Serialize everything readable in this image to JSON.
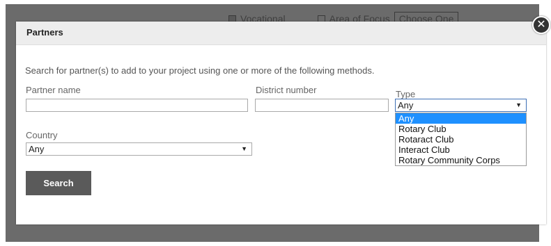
{
  "background": {
    "vocational_label": "Vocational",
    "area_of_focus_label": "Area of Focus",
    "area_of_focus_select": "Choose One"
  },
  "modal": {
    "title": "Partners",
    "close_glyph": "✕",
    "instructions": "Search for partner(s) to add to your project using one or more of the following methods.",
    "partner_name": {
      "label": "Partner name",
      "value": "",
      "placeholder": ""
    },
    "district_number": {
      "label": "District number",
      "value": "",
      "placeholder": ""
    },
    "type": {
      "label": "Type",
      "selected": "Any",
      "options": [
        "Any",
        "Rotary Club",
        "Rotaract Club",
        "Interact Club",
        "Rotary Community Corps"
      ],
      "highlighted_index": 0
    },
    "country": {
      "label": "Country",
      "selected": "Any"
    },
    "search_label": "Search"
  },
  "colors": {
    "highlight": "#1e90ff",
    "button": "#5a5a5a",
    "header": "#ededed",
    "overlay": "#6b6b6b"
  }
}
